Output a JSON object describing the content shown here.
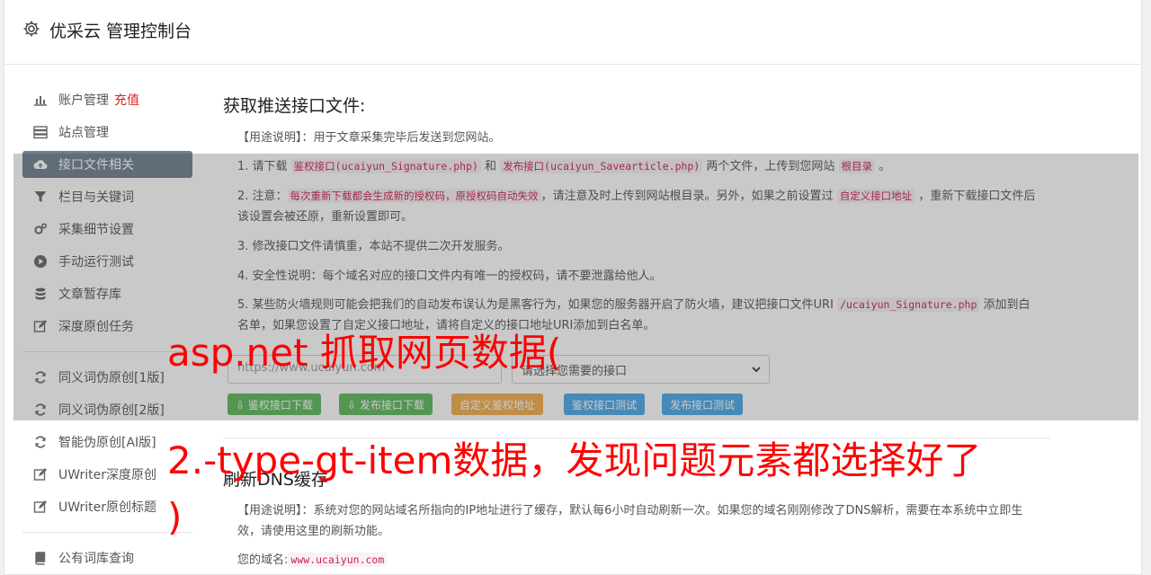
{
  "header": {
    "title": "优采云 管理控制台"
  },
  "sidebar": {
    "items": [
      {
        "label": "账户管理",
        "extra": "充值",
        "icon": "bar-chart-icon"
      },
      {
        "label": "站点管理",
        "icon": "server-icon"
      },
      {
        "label": "接口文件相关",
        "icon": "cloud-upload-icon",
        "active": true
      },
      {
        "label": "栏目与关键词",
        "icon": "filter-icon"
      },
      {
        "label": "采集细节设置",
        "icon": "cogs-icon"
      },
      {
        "label": "手动运行测试",
        "icon": "play-circle-icon"
      },
      {
        "label": "文章暂存库",
        "icon": "database-icon"
      },
      {
        "label": "深度原创任务",
        "icon": "edit-icon"
      },
      {
        "label": "同义词伪原创[1版]",
        "icon": "refresh-icon"
      },
      {
        "label": "同义词伪原创[2版]",
        "icon": "refresh-icon"
      },
      {
        "label": "智能伪原创[AI版]",
        "icon": "refresh-icon"
      },
      {
        "label": "UWriter深度原创",
        "icon": "edit-icon"
      },
      {
        "label": "UWriter原创标题",
        "icon": "edit-icon"
      },
      {
        "label": "公有词库查询",
        "icon": "book-icon"
      }
    ]
  },
  "section1": {
    "title": "获取推送接口文件:",
    "usage": "【用途说明】：用于文章采集完毕后发送到您网站。",
    "item1_pre": "1. 请下载 ",
    "item1_code1": "鉴权接口(ucaiyun_Signature.php)",
    "item1_mid": " 和 ",
    "item1_code2": "发布接口(ucaiyun_Savearticle.php)",
    "item1_post": " 两个文件，上传到您网站 ",
    "item1_code3": "根目录",
    "item1_end": " 。",
    "item2_pre": "2. 注意：",
    "item2_code1": "每次重新下载都会生成新的授权码，原授权码自动失效",
    "item2_mid": "，请注意及时上传到网站根目录。另外，如果之前设置过 ",
    "item2_code2": "自定义接口地址",
    "item2_post": " ，重新下载接口文件后该设置会被还原，重新设置即可。",
    "item3": "3. 修改接口文件请慎重，本站不提供二次开发服务。",
    "item4": "4. 安全性说明：每个域名对应的接口文件内有唯一的授权码，请不要泄露给他人。",
    "item5_pre": "5. 某些防火墙规则可能会把我们的自动发布误认为是黑客行为，如果您的服务器开启了防火墙，建议把接口文件URI ",
    "item5_code": "/ucaiyun_Signature.php",
    "item5_post": " 添加到白名单，如果您设置了自定义接口地址，请将自定义的接口地址URI添加到白名单。",
    "url_value": "https://www.ucaiyun.com",
    "select_value": "请选择您需要的接口",
    "buttons": {
      "auth_download": "鉴权接口下载",
      "publish_download": "发布接口下载",
      "custom_auth": "自定义鉴权地址",
      "auth_test": "鉴权接口测试",
      "publish_test": "发布接口测试"
    }
  },
  "section2": {
    "title": "刷新DNS缓存",
    "usage": "【用途说明】：系统对您的网站域名所指向的IP地址进行了缓存，默认每6小时自动刷新一次。如果您的域名刚刚修改了DNS解析，需要在本系统中立即生效，请使用这里的刷新功能。",
    "domain_label": "您的域名:",
    "domain_value": "www.ucaiyun.com"
  },
  "watermark": {
    "line1": "asp.net 抓取网页数据(",
    "line2": "2.-type-gt-item数据，发现问题元素都选择好了",
    "line3": ")"
  },
  "colors": {
    "active_bg": "#6e7f8f",
    "code_red": "#c7254e",
    "watermark": "#ff0000",
    "btn_green": "#5cb85c",
    "btn_orange": "#f0ad4e",
    "btn_blue": "#4aa8e8"
  }
}
